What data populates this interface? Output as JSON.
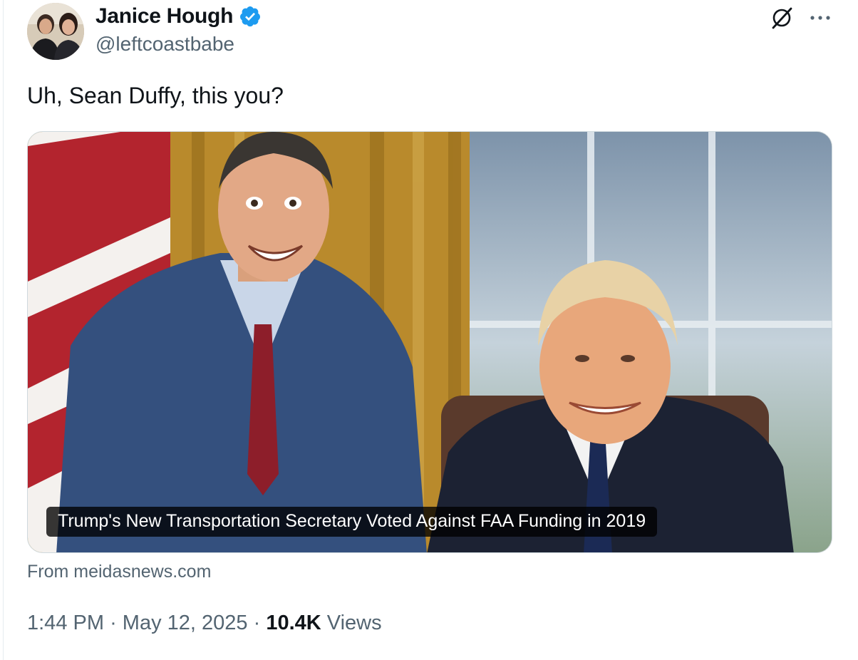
{
  "author": {
    "display_name": "Janice Hough",
    "handle": "@leftcoastbabe",
    "verified": true
  },
  "tweet": {
    "text": "Uh, Sean Duffy, this you?"
  },
  "link_card": {
    "caption": "Trump's New Transportation Secretary Voted Against FAA Funding in 2019",
    "source": "From meidasnews.com"
  },
  "meta": {
    "time": "1:44 PM",
    "separator": "·",
    "date": "May 12, 2025",
    "views_count": "10.4K",
    "views_label": "Views"
  },
  "icons": {
    "verified": "verified-badge-icon",
    "grok": "grok-icon",
    "more": "more-options-icon"
  },
  "colors": {
    "verified_blue": "#1d9bf0",
    "secondary_text": "#536471",
    "primary_text": "#0f1419"
  }
}
